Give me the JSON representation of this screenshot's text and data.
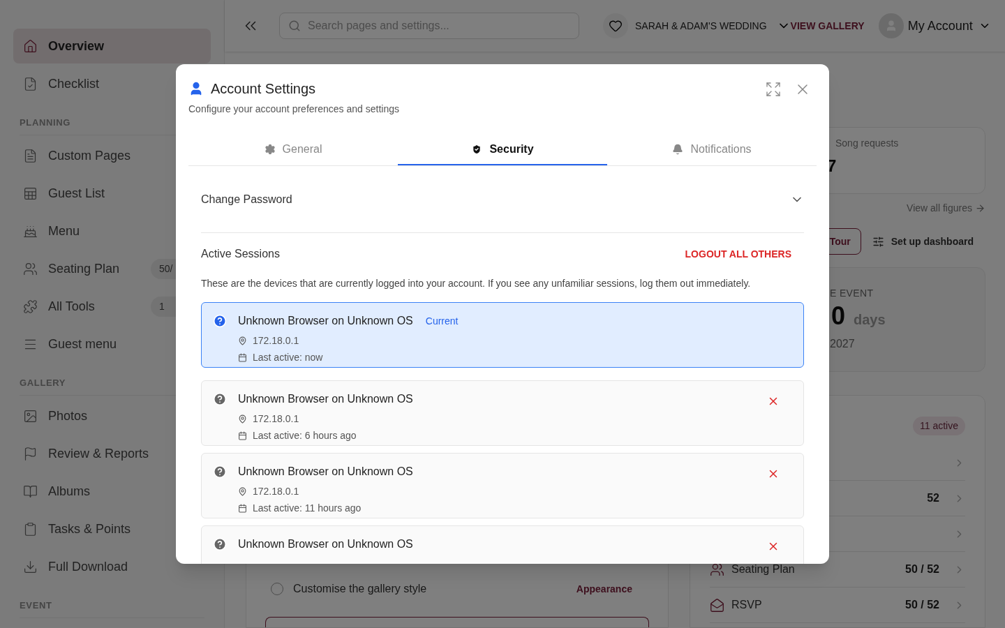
{
  "sidebar": {
    "sections": [
      {
        "items": [
          {
            "label": "Overview",
            "selected": true
          },
          {
            "label": "Checklist",
            "selected": false
          }
        ]
      },
      {
        "heading": "PLANNING",
        "items": [
          {
            "label": "Custom Pages",
            "selected": false
          },
          {
            "label": "Guest List",
            "selected": false
          },
          {
            "label": "Menu",
            "selected": false
          },
          {
            "label": "Seating Plan",
            "selected": false,
            "badge": "50/"
          },
          {
            "label": "All Tools",
            "selected": false,
            "badge": "1"
          },
          {
            "label": "Guest menu",
            "selected": false
          }
        ]
      },
      {
        "heading": "GALLERY",
        "items": [
          {
            "label": "Photos",
            "selected": false
          },
          {
            "label": "Review & Reports",
            "selected": false
          },
          {
            "label": "Albums",
            "selected": false
          },
          {
            "label": "Tasks & Points",
            "selected": false
          },
          {
            "label": "Full Download",
            "selected": false
          }
        ]
      },
      {
        "heading": "EVENT"
      }
    ]
  },
  "topbar": {
    "search": {
      "placeholder": "Search pages and settings..."
    },
    "event": "SARAH & ADAM'S WEDDING",
    "view_gallery": "VIEW GALLERY",
    "account": "My Account"
  },
  "dashboard": {
    "stat": {
      "label": "Song requests",
      "value": "7"
    },
    "view_all": "View all figures",
    "tour": "Tour",
    "setup": "Set up dashboard",
    "countdown": {
      "label": "E EVENT",
      "number": "0",
      "unit": "days",
      "date": "2027"
    },
    "list": {
      "badge": "11 active",
      "rows": [
        {},
        {
          "value": "52"
        },
        {},
        {
          "label": "Seating Plan",
          "value": "50 / 52"
        },
        {
          "label": "RSVP",
          "value": "50 / 52"
        }
      ]
    },
    "task": {
      "label": "Customise the gallery style",
      "checked": false,
      "link": "Appearance"
    }
  },
  "modal": {
    "title": "Account Settings",
    "subtitle": "Configure your account preferences and settings",
    "tabs": [
      {
        "label": "General",
        "selected": false
      },
      {
        "label": "Security",
        "selected": true
      },
      {
        "label": "Notifications",
        "selected": false
      }
    ],
    "accordion": {
      "label": "Change Password",
      "expanded": false
    },
    "sessions_header": {
      "title": "Active Sessions",
      "action": "LOGOUT ALL OTHERS",
      "description": "These are the devices that are currently logged into your account. If you see any unfamiliar sessions, log them out immediately."
    },
    "sessions": [
      {
        "title": "Unknown Browser on Unknown OS",
        "current": true,
        "current_label": "Current",
        "ip": "172.18.0.1",
        "last_active": "Last active: now"
      },
      {
        "title": "Unknown Browser on Unknown OS",
        "current": false,
        "ip": "172.18.0.1",
        "last_active": "Last active: 6 hours ago"
      },
      {
        "title": "Unknown Browser on Unknown OS",
        "current": false,
        "ip": "172.18.0.1",
        "last_active": "Last active: 11 hours ago"
      },
      {
        "title": "Unknown Browser on Unknown OS",
        "current": false
      }
    ]
  }
}
